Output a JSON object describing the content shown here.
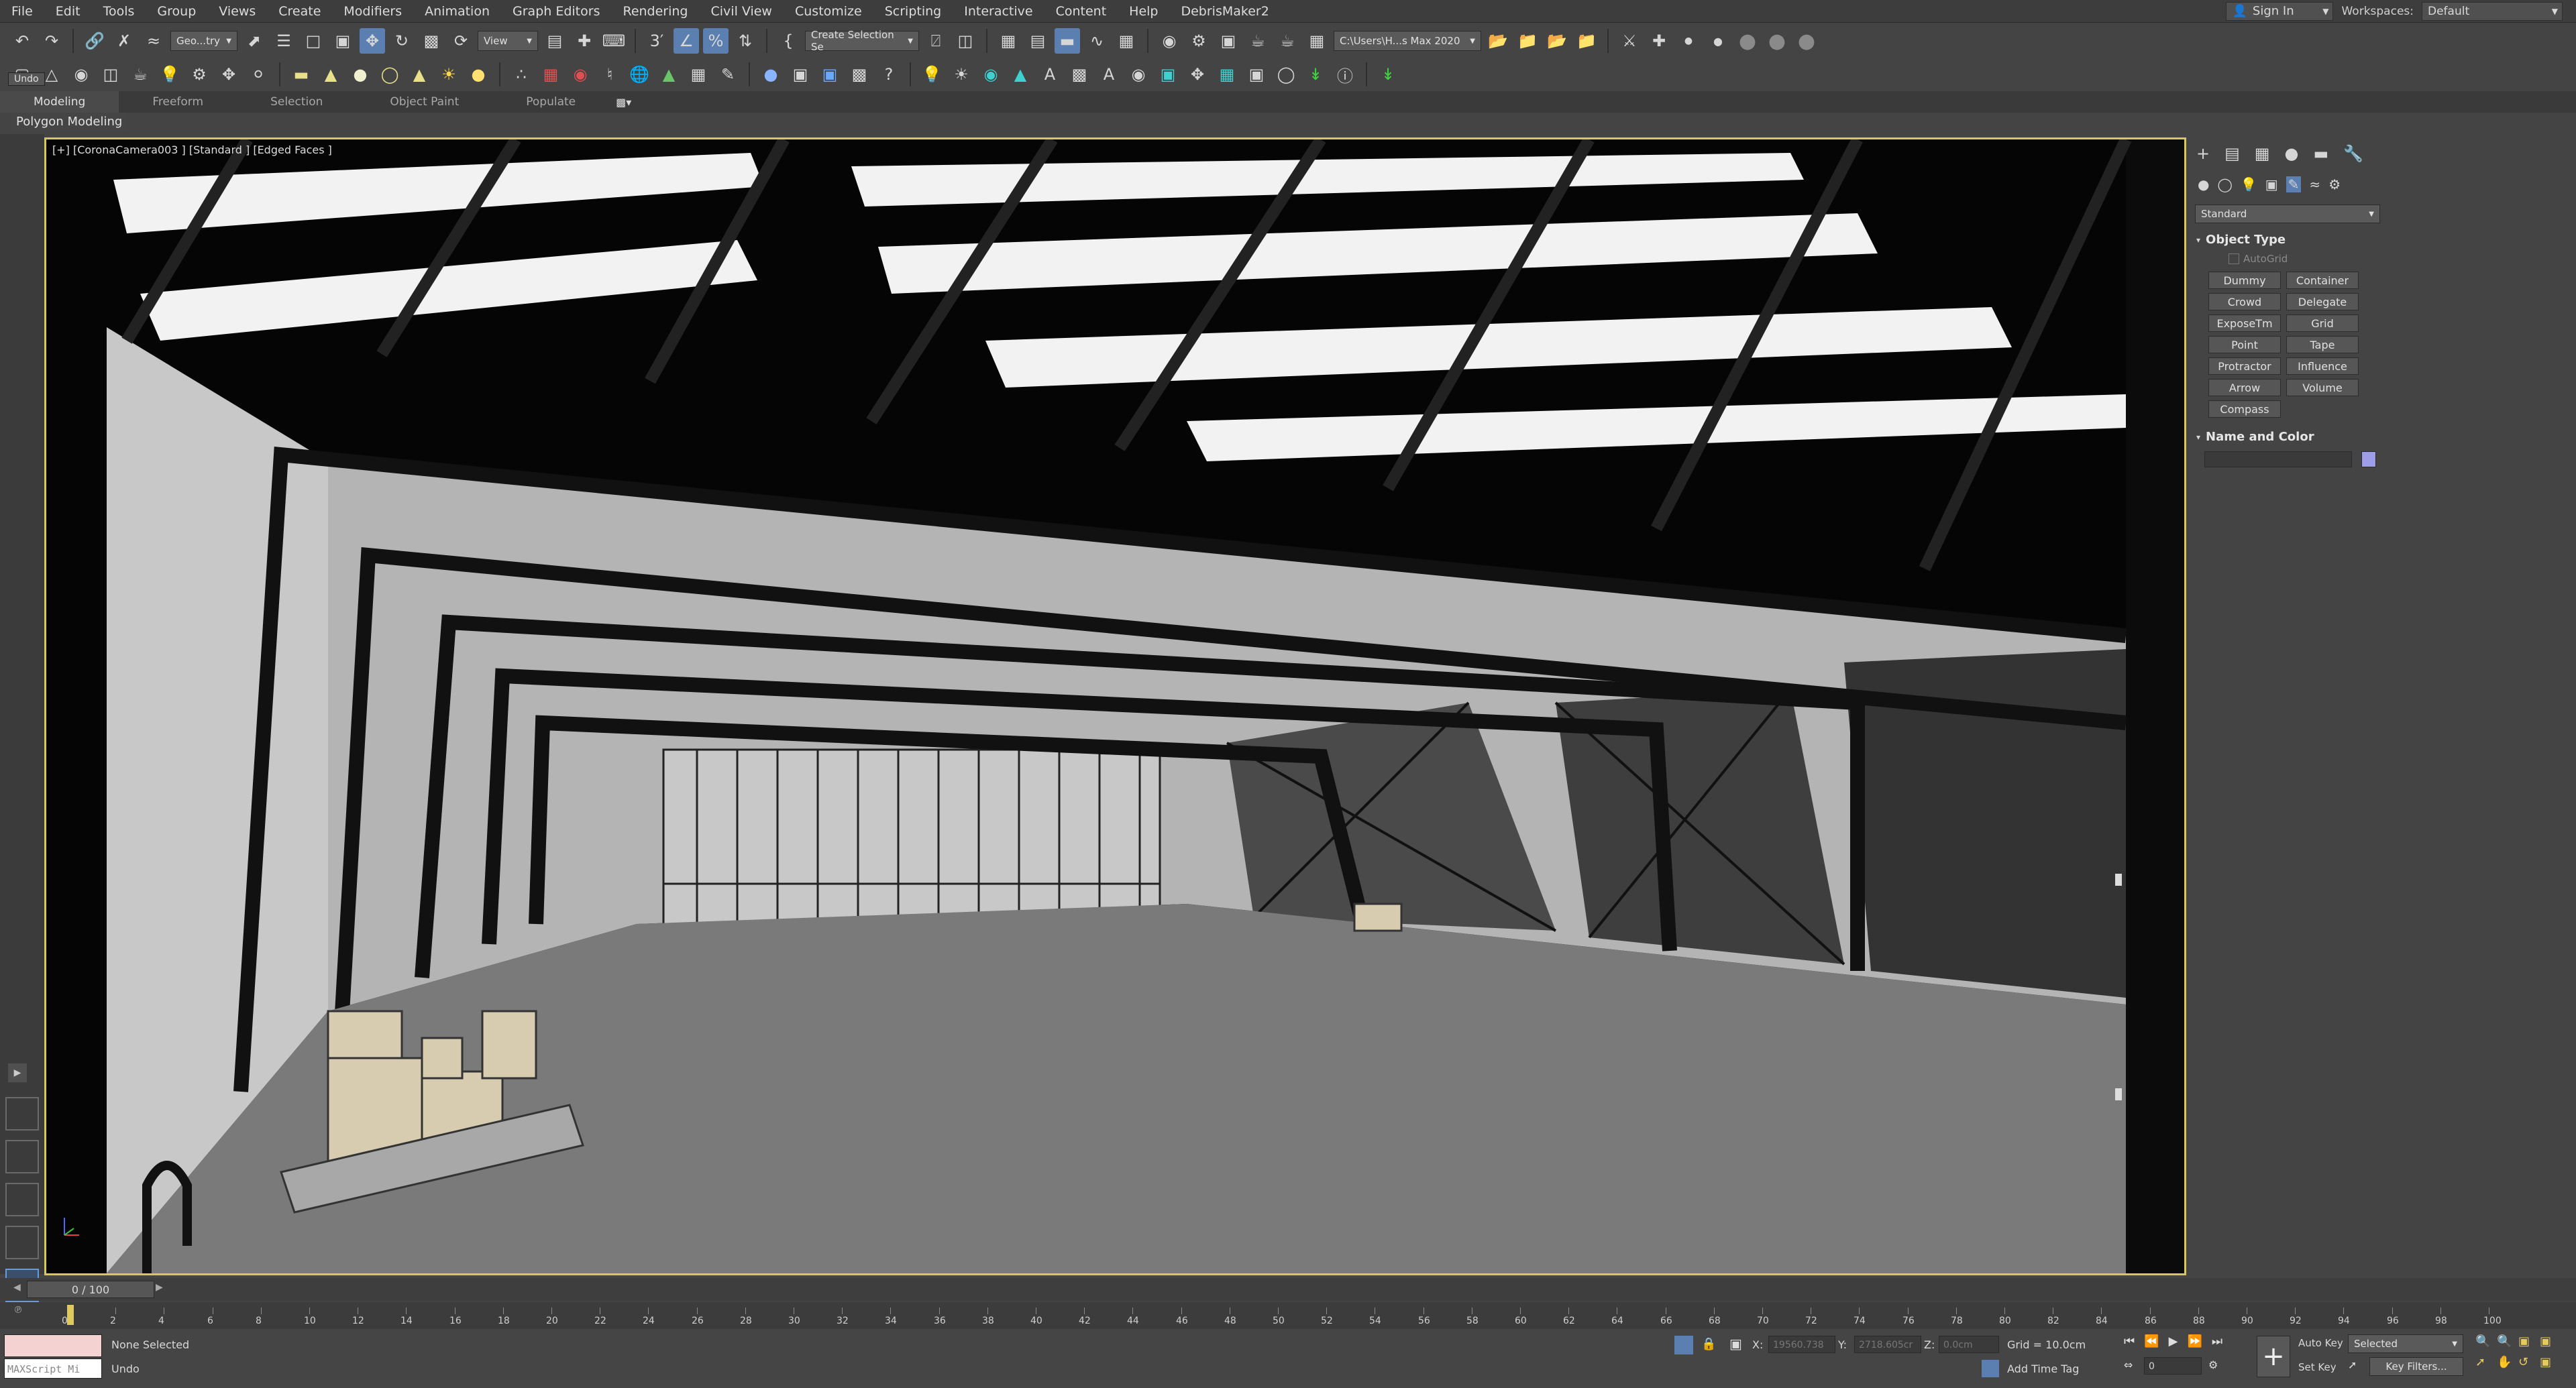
{
  "menu": [
    "File",
    "Edit",
    "Tools",
    "Group",
    "Views",
    "Create",
    "Modifiers",
    "Animation",
    "Graph Editors",
    "Rendering",
    "Civil View",
    "Customize",
    "Scripting",
    "Interactive",
    "Content",
    "Help",
    "DebrisMaker2"
  ],
  "account": {
    "signin": "Sign In",
    "workspaces_label": "Workspaces:",
    "workspace": "Default"
  },
  "toolbar": {
    "undo_tooltip": "Undo",
    "selection_filter": "Geo...try",
    "ref_coord": "View",
    "named_selection": "Create Selection Se",
    "project_path": "C:\\Users\\H...s Max 2020"
  },
  "ribbon": {
    "tabs": [
      "Modeling",
      "Freeform",
      "Selection",
      "Object Paint",
      "Populate"
    ],
    "subtitle": "Polygon Modeling"
  },
  "viewport": {
    "label": "[+] [CoronaCamera003 ] [Standard ] [Edged Faces ]"
  },
  "command_panel": {
    "category": "Standard",
    "object_type_title": "Object Type",
    "autogrid": "AutoGrid",
    "buttons": [
      "Dummy",
      "Container",
      "Crowd",
      "Delegate",
      "ExposeTm",
      "Grid",
      "Point",
      "Tape",
      "Protractor",
      "Influence",
      "Arrow",
      "Volume",
      "Compass"
    ],
    "name_color_title": "Name and Color",
    "swatch_color": "#9d9de8"
  },
  "timeline": {
    "frame_display": "0 / 100",
    "ticks": [
      "0",
      "2",
      "4",
      "6",
      "8",
      "10",
      "12",
      "14",
      "16",
      "18",
      "20",
      "22",
      "24",
      "26",
      "28",
      "30",
      "32",
      "34",
      "36",
      "38",
      "40",
      "42",
      "44",
      "46",
      "48",
      "50",
      "52",
      "54",
      "56",
      "58",
      "60",
      "62",
      "64",
      "66",
      "68",
      "70",
      "72",
      "74",
      "76",
      "78",
      "80",
      "82",
      "84",
      "86",
      "88",
      "90",
      "92",
      "94",
      "96",
      "98",
      "100"
    ]
  },
  "status": {
    "maxscript": "MAXScript Mi",
    "selection": "None Selected",
    "prompt": "Undo",
    "x_label": "X:",
    "x_value": "19560.738",
    "y_label": "Y:",
    "y_value": "2718.605cr",
    "z_label": "Z:",
    "z_value": "0.0cm",
    "grid": "Grid = 10.0cm",
    "add_time_tag": "Add Time Tag",
    "auto_key": "Auto Key",
    "set_key": "Set Key",
    "key_mode": "Selected",
    "key_filters": "Key Filters...",
    "frame_value": "0"
  }
}
